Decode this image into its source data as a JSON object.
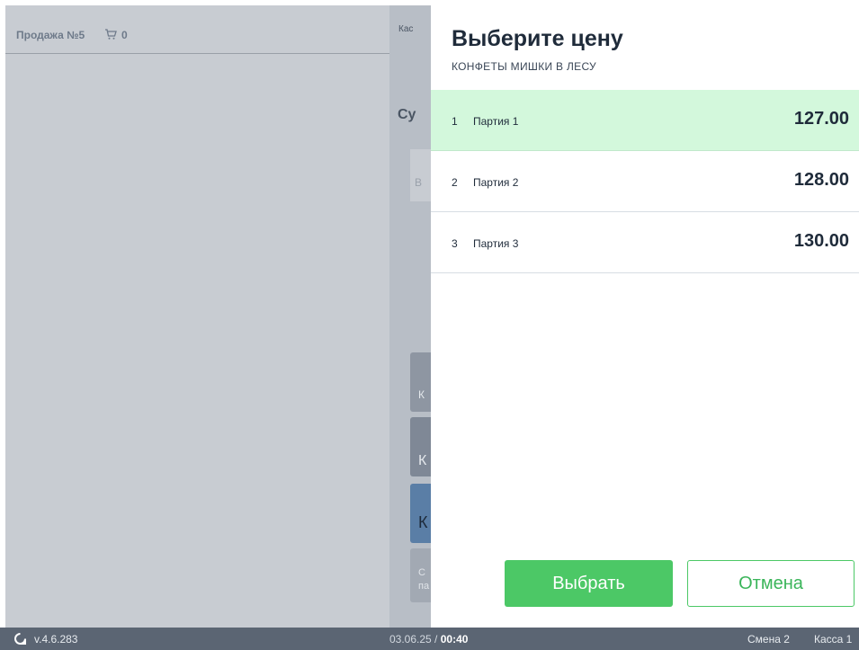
{
  "left_panel": {
    "sale_title": "Продажа №5",
    "cart_count": "0",
    "cart_icon": "cart-icon"
  },
  "mid_panel": {
    "label_kas": "Кас",
    "label_su": "Су",
    "box_b": "В",
    "btn1": "К",
    "btn2": "К",
    "btn3": "К",
    "btn4_line1": "С",
    "btn4_line2": "па"
  },
  "dialog": {
    "title": "Выберите цену",
    "product": "КОНФЕТЫ МИШКИ В ЛЕСУ",
    "items": [
      {
        "index": "1",
        "name": "Партия 1",
        "price": "127.00",
        "selected": true
      },
      {
        "index": "2",
        "name": "Партия 2",
        "price": "128.00",
        "selected": false
      },
      {
        "index": "3",
        "name": "Партия 3",
        "price": "130.00",
        "selected": false
      }
    ],
    "select_label": "Выбрать",
    "cancel_label": "Отмена"
  },
  "status_bar": {
    "logo_icon": "app-logo-icon",
    "version": "v.4.6.283",
    "date": "03.06.25",
    "date_sep": " / ",
    "time": "00:40",
    "shift": "Смена 2",
    "register": "Касса 1"
  },
  "colors": {
    "accent_green": "#4cc866",
    "selected_row": "#d3f8dc",
    "status_bar": "#5b6573",
    "overlay_panel": "#c8ccd2"
  }
}
